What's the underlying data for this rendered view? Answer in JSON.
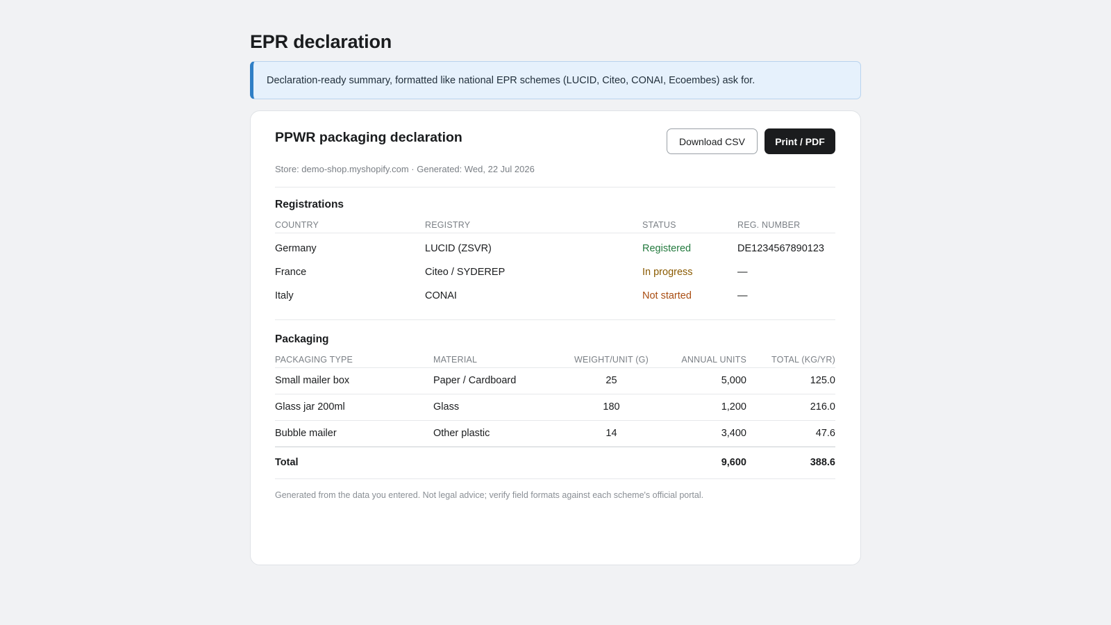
{
  "page": {
    "title": "EPR declaration",
    "banner": "Declaration-ready summary, formatted like national EPR schemes (LUCID, Citeo, CONAI, Ecoembes) ask for."
  },
  "card": {
    "title": "PPWR packaging declaration",
    "subtitle": "Store: demo-shop.myshopify.com · Generated: Wed, 22 Jul 2026",
    "download_label": "Download CSV",
    "print_label": "Print / PDF"
  },
  "registrations": {
    "title": "Registrations",
    "columns": [
      "Country",
      "Registry",
      "Status",
      "Reg. number"
    ],
    "rows": [
      {
        "country": "Germany",
        "registry": "LUCID (ZSVR)",
        "status": "Registered",
        "reg_number": "DE1234567890123"
      },
      {
        "country": "France",
        "registry": "Citeo / SYDEREP",
        "status": "In progress",
        "reg_number": "—"
      },
      {
        "country": "Italy",
        "registry": "CONAI",
        "status": "Not started",
        "reg_number": "—"
      }
    ]
  },
  "packaging": {
    "title": "Packaging",
    "columns": [
      "Packaging type",
      "Material",
      "Weight/unit (g)",
      "Annual units",
      "Total (kg/yr)"
    ],
    "rows": [
      {
        "type": "Small mailer box",
        "material": "Paper / Cardboard",
        "weight": "25",
        "units": "5,000",
        "total": "125.0"
      },
      {
        "type": "Glass jar 200ml",
        "material": "Glass",
        "weight": "180",
        "units": "1,200",
        "total": "216.0"
      },
      {
        "type": "Bubble mailer",
        "material": "Other plastic",
        "weight": "14",
        "units": "3,400",
        "total": "47.6"
      }
    ],
    "total": {
      "label": "Total",
      "units": "9,600",
      "total": "388.6"
    }
  },
  "footer_note": "Generated from the data you entered. Not legal advice; verify field formats against each scheme's official portal.",
  "colors": {
    "accent": "#2f7fc6",
    "registered": "#237a3e",
    "in_progress": "#8a5a00",
    "not_started": "#a94d12"
  }
}
